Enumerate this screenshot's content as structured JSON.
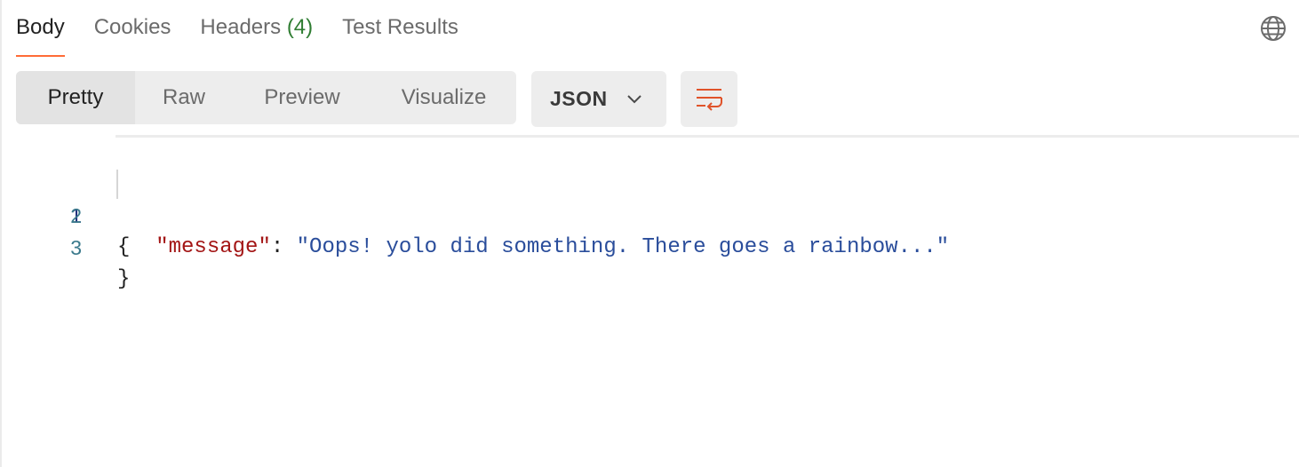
{
  "tabs": {
    "body": "Body",
    "cookies": "Cookies",
    "headers": "Headers",
    "headers_count": "(4)",
    "test_results": "Test Results"
  },
  "view_modes": {
    "pretty": "Pretty",
    "raw": "Raw",
    "preview": "Preview",
    "visualize": "Visualize",
    "selected": "Pretty"
  },
  "language": {
    "selected": "JSON"
  },
  "editor": {
    "lines": [
      {
        "number": "1",
        "open_brace": "{"
      },
      {
        "number": "2",
        "indent": "   ",
        "key": "\"message\"",
        "colon": ": ",
        "value": "\"Oops! yolo did something. There goes a rainbow...\""
      },
      {
        "number": "3",
        "close_brace": "}"
      }
    ]
  },
  "icons": {
    "globe": "globe-icon",
    "chevron": "chevron-down-icon",
    "wrap": "wrap-lines-icon"
  },
  "colors": {
    "accent": "#ff6c37",
    "count_green": "#2f7d32",
    "json_key": "#a31515",
    "json_string": "#2a4d9b"
  }
}
